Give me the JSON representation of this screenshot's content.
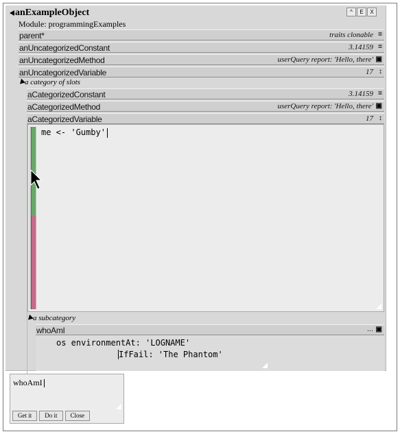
{
  "window": {
    "title": "anExampleObject",
    "module": "Module: programmingExamples",
    "buttons": [
      "^",
      "E",
      "X"
    ]
  },
  "slots": [
    {
      "name": "parent*",
      "value": "traits clonable",
      "indicator": "="
    },
    {
      "name": "anUncategorizedConstant",
      "value": "3.14159",
      "indicator": "="
    },
    {
      "name": "anUncategorizedMethod",
      "value": "userQuery report: 'Hello, there'",
      "indicator": "▣"
    },
    {
      "name": "anUncategorizedVariable",
      "value": "17",
      "indicator": "↕"
    }
  ],
  "category": {
    "label": "a category of slots",
    "slots": [
      {
        "name": "aCategorizedConstant",
        "value": "3.14159",
        "indicator": "="
      },
      {
        "name": "aCategorizedMethod",
        "value": "userQuery report: 'Hello, there'",
        "indicator": "▣"
      },
      {
        "name": "aCategorizedVariable",
        "value": "17",
        "indicator": "↕"
      }
    ]
  },
  "editor": {
    "code": "me <- 'Gumby'"
  },
  "subcategory": {
    "label": "a subcategory",
    "slot": {
      "name": "whoAmI",
      "value": "...",
      "indicator": "▣"
    },
    "code_line1": "os environmentAt: 'LOGNAME'",
    "code_line2": "IfFail: 'The Phantom'"
  },
  "evaluator": {
    "text": "whoAmI",
    "buttons": {
      "get": "Get it",
      "do": "Do it",
      "close": "Close"
    }
  }
}
